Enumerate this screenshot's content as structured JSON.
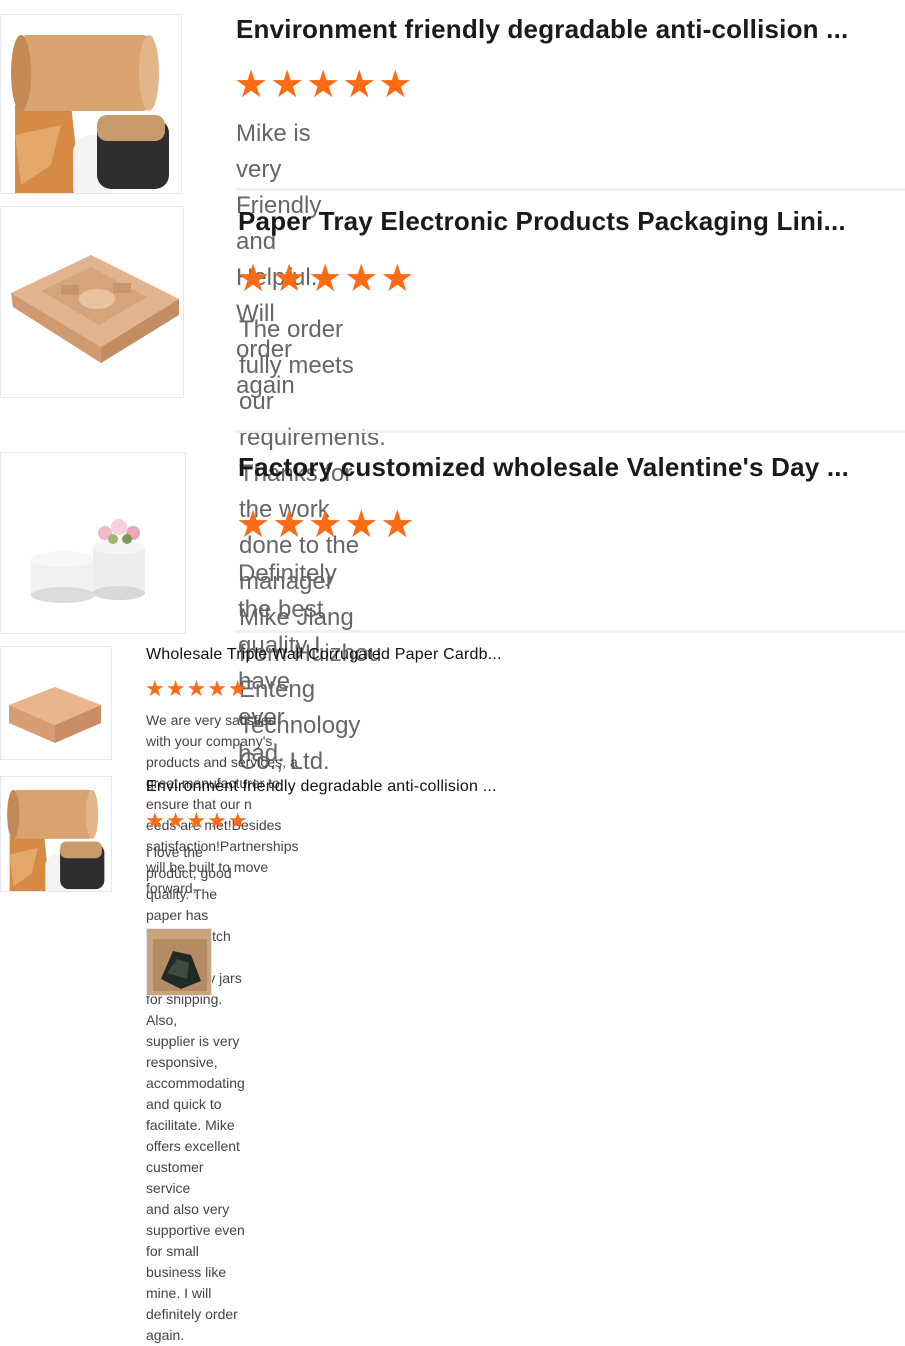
{
  "reviews": [
    {
      "title": "Environment friendly degradable anti-collision ...",
      "rating": 5,
      "stars": "★★★★★",
      "lines": [
        "Mike is very Friendly and Helpful. Will order again"
      ]
    },
    {
      "title": "Paper Tray Electronic Products Packaging Lini...",
      "rating": 5,
      "stars": "★★★★★",
      "lines": [
        "The order fully meets our requirements.",
        "Thanks for the work done to the manager",
        "Mike Jiang from Huizhou Enteng Technology Co., Ltd."
      ]
    },
    {
      "title": "Factory customized wholesale Valentine's Day ...",
      "rating": 5,
      "stars": "★★★★★",
      "lines": [
        "Definitely the best quality I have ever had."
      ]
    },
    {
      "title": "Wholesale Triple Wall Corrugated Paper Cardb...",
      "rating": 5,
      "stars": "★★★★★",
      "lines": [
        "We are very satisfied with your company's products and services, a great manufacturer to ensure that our n",
        "eeds are met!Besides satisfaction!Partnerships will be built to move forward."
      ]
    },
    {
      "title": "Environment friendly degradable anti-collision ...",
      "rating": 5,
      "stars": "★★★★★",
      "lines": [
        "I love the product, good quality. The paper has strong stretch enough to support my jars for shipping. Also,",
        "supplier is very responsive, accommodating and quick to facilitate.  Mike offers excellent customer service",
        "and also very supportive even for small business like mine. I will definitely order again."
      ]
    }
  ]
}
